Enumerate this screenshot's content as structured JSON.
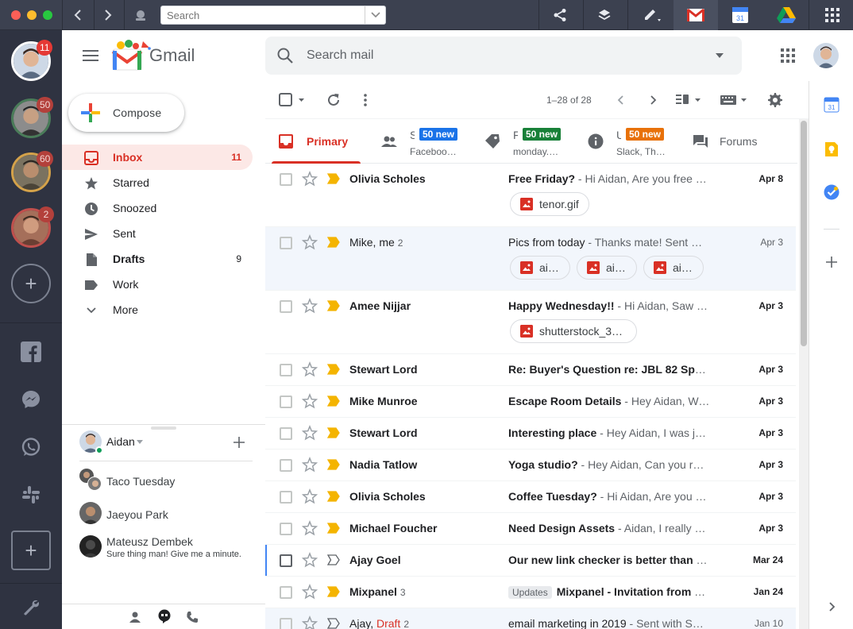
{
  "titlebar": {
    "search_placeholder": "Search"
  },
  "dock": {
    "accounts": [
      {
        "name": "account-1",
        "badge": "11"
      },
      {
        "name": "account-2",
        "badge": "50"
      },
      {
        "name": "account-3",
        "badge": "60"
      },
      {
        "name": "account-4",
        "badge": "2"
      }
    ],
    "icons": [
      "facebook-icon",
      "messenger-icon",
      "whatsapp-icon",
      "slack-icon"
    ]
  },
  "header": {
    "logo_text": "Gmail",
    "search_placeholder": "Search mail"
  },
  "sidebar": {
    "compose_label": "Compose",
    "items": [
      {
        "label": "Inbox",
        "count": "11"
      },
      {
        "label": "Starred",
        "count": ""
      },
      {
        "label": "Snoozed",
        "count": ""
      },
      {
        "label": "Sent",
        "count": ""
      },
      {
        "label": "Drafts",
        "count": "9"
      },
      {
        "label": "Work",
        "count": ""
      },
      {
        "label": "More",
        "count": ""
      }
    ],
    "hangouts": {
      "me": "Aidan",
      "contacts": [
        {
          "name": "Taco Tuesday",
          "sub": ""
        },
        {
          "name": "Jaeyou Park",
          "sub": ""
        },
        {
          "name": "Mateusz Dembek",
          "sub": "Sure thing man! Give me a minute."
        }
      ]
    }
  },
  "toolbar": {
    "range": "1–28 of 28"
  },
  "tabs": [
    {
      "label": "Primary",
      "sub": "",
      "badge": ""
    },
    {
      "label": "S",
      "sub": "Faceboo…",
      "badge": "50 new",
      "badge_color": "#1a73e8"
    },
    {
      "label": "F",
      "sub": "monday.…",
      "badge": "50 new",
      "badge_color": "#188038"
    },
    {
      "label": "U",
      "sub": "Slack, Th…",
      "badge": "50 new",
      "badge_color": "#e8710a"
    },
    {
      "label": "Forums",
      "sub": "",
      "badge": ""
    }
  ],
  "emails": [
    {
      "sender": "Olivia Scholes",
      "num": "",
      "subject": "Free Friday?",
      "snippet": " - Hi Aidan, Are you free F…",
      "date": "Apr 8",
      "unread": true,
      "important": true,
      "chips": [
        "tenor.gif"
      ]
    },
    {
      "sender": "Mike, me",
      "num": "2",
      "subject": "Pics from today",
      "snippet": " - Thanks mate! Sent …",
      "date": "Apr 3",
      "unread": false,
      "important": true,
      "chips": [
        "ai…",
        "ai…",
        "ai…"
      ]
    },
    {
      "sender": "Amee Nijjar",
      "num": "",
      "subject": "Happy Wednesday!!",
      "snippet": " - Hi Aidan, Saw t…",
      "date": "Apr 3",
      "unread": true,
      "important": true,
      "chips": [
        "shutterstock_3…"
      ]
    },
    {
      "sender": "Stewart Lord",
      "num": "",
      "subject": "Re: Buyer's Question re: JBL 82 Spea…",
      "snippet": "",
      "date": "Apr 3",
      "unread": true,
      "important": true,
      "chips": []
    },
    {
      "sender": "Mike Munroe",
      "num": "",
      "subject": "Escape Room Details",
      "snippet": " - Hey Aidan, We'…",
      "date": "Apr 3",
      "unread": true,
      "important": true,
      "chips": []
    },
    {
      "sender": "Stewart Lord",
      "num": "",
      "subject": "Interesting place",
      "snippet": " - Hey Aidan, I was ju…",
      "date": "Apr 3",
      "unread": true,
      "important": true,
      "chips": []
    },
    {
      "sender": "Nadia Tatlow",
      "num": "",
      "subject": "Yoga studio?",
      "snippet": " - Hey Aidan, Can you re…",
      "date": "Apr 3",
      "unread": true,
      "important": true,
      "chips": []
    },
    {
      "sender": "Olivia Scholes",
      "num": "",
      "subject": "Coffee Tuesday?",
      "snippet": " - Hi Aidan, Are you s…",
      "date": "Apr 3",
      "unread": true,
      "important": true,
      "chips": []
    },
    {
      "sender": "Michael Foucher",
      "num": "",
      "subject": "Need Design Assets",
      "snippet": " - Aidan, I really n…",
      "date": "Apr 3",
      "unread": true,
      "important": true,
      "chips": []
    },
    {
      "sender": "Ajay Goel",
      "num": "",
      "subject": "Our new link checker is better than M…",
      "snippet": "",
      "date": "Mar 24",
      "unread": true,
      "important": false,
      "selected": true,
      "chips": []
    },
    {
      "sender": "Mixpanel",
      "num": "3",
      "label": "Updates",
      "subject": "Mixpanel - Invitation from N…",
      "snippet": "",
      "date": "Jan 24",
      "unread": true,
      "important": true,
      "chips": []
    },
    {
      "sender": "Ajay,",
      "draft": "Draft",
      "num": "2",
      "subject": "email marketing in 2019",
      "snippet": " - Sent with S…",
      "date": "Jan 10",
      "unread": false,
      "important": false,
      "chips": []
    }
  ],
  "colors": {
    "accent": "#d93025",
    "dock_bg": "#2f3341",
    "titlebar_bg": "#3c4150",
    "important": "#f4b400"
  }
}
